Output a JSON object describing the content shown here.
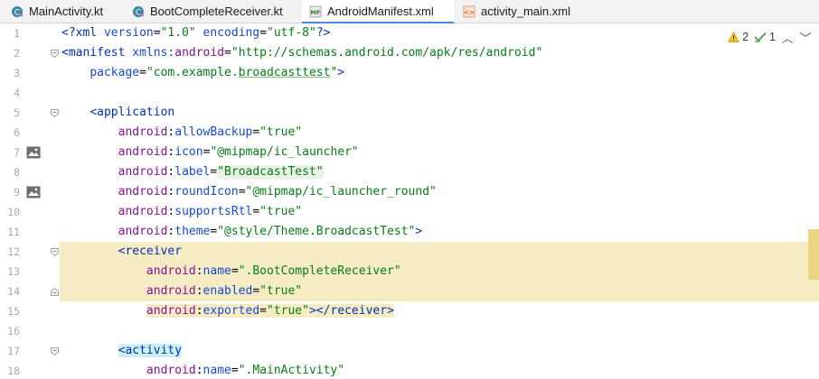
{
  "tabs": [
    {
      "label": "MainActivity.kt",
      "icon": "kotlin-class-icon",
      "active": false
    },
    {
      "label": "BootCompleteReceiver.kt",
      "icon": "kotlin-class-icon",
      "active": false
    },
    {
      "label": "AndroidManifest.xml",
      "icon": "manifest-file-icon",
      "active": true
    },
    {
      "label": "activity_main.xml",
      "icon": "layout-xml-icon",
      "active": false
    }
  ],
  "inspection": {
    "warnings": "2",
    "weak_warnings": "1"
  },
  "line_numbers": [
    "1",
    "2",
    "3",
    "4",
    "5",
    "6",
    "7",
    "8",
    "9",
    "10",
    "11",
    "12",
    "13",
    "14",
    "15",
    "16",
    "17",
    "18"
  ],
  "code": {
    "l1": {
      "a": "<?xml ",
      "b": "version",
      "c": "=",
      "d": "\"1.0\"",
      "e": " encoding",
      "f": "=",
      "g": "\"utf-8\"",
      "h": "?>"
    },
    "l2": {
      "a": "<manifest ",
      "b": "xmlns:",
      "c": "android",
      "d": "=",
      "e": "\"http://schemas.android.com/apk/res/android\""
    },
    "l3": {
      "indent": "    ",
      "a": "package",
      "b": "=",
      "c": "\"com.example.",
      "d": "broadcasttest",
      "e": "\"",
      "f": ">"
    },
    "l5": {
      "indent": "    ",
      "a": "<",
      "b": "application"
    },
    "l6": {
      "indent": "        ",
      "ns": "android",
      "sep": ":",
      "attr": "allowBackup",
      "eq": "=",
      "val": "\"true\""
    },
    "l7": {
      "indent": "        ",
      "ns": "android",
      "sep": ":",
      "attr": "icon",
      "eq": "=",
      "val": "\"@mipmap/ic_launcher\""
    },
    "l8": {
      "indent": "        ",
      "ns": "android",
      "sep": ":",
      "attr": "label",
      "eq": "=",
      "val": "\"BroadcastTest\""
    },
    "l9": {
      "indent": "        ",
      "ns": "android",
      "sep": ":",
      "attr": "roundIcon",
      "eq": "=",
      "val": "\"@mipmap/ic_launcher_round\""
    },
    "l10": {
      "indent": "        ",
      "ns": "android",
      "sep": ":",
      "attr": "supportsRtl",
      "eq": "=",
      "val": "\"true\""
    },
    "l11": {
      "indent": "        ",
      "ns": "android",
      "sep": ":",
      "attr": "theme",
      "eq": "=",
      "val": "\"@style/Theme.BroadcastTest\"",
      "end": ">"
    },
    "l12": {
      "indent": "        ",
      "a": "<",
      "b": "receiver"
    },
    "l13": {
      "indent": "            ",
      "ns": "android",
      "sep": ":",
      "attr": "name",
      "eq": "=",
      "val": "\".BootCompleteReceiver\""
    },
    "l14": {
      "indent": "            ",
      "ns": "android",
      "sep": ":",
      "attr": "enabled",
      "eq": "=",
      "val": "\"true\""
    },
    "l15": {
      "indent": "            ",
      "ns": "android",
      "sep": ":",
      "attr": "exported",
      "eq": "=",
      "val": "\"true\"",
      "end": "></",
      "tag": "receiver",
      "close": ">"
    },
    "l17": {
      "indent": "        ",
      "a": "<",
      "b": "activity"
    },
    "l18": {
      "indent": "            ",
      "ns": "android",
      "sep": ":",
      "attr": "name",
      "eq": "=",
      "val": "\".MainActivity\""
    }
  },
  "colors": {
    "accent": "#4a8bd6",
    "highlight": "#f6ecc4",
    "tag": "#0033b3",
    "attr_ns": "#871094",
    "value": "#067d17"
  }
}
